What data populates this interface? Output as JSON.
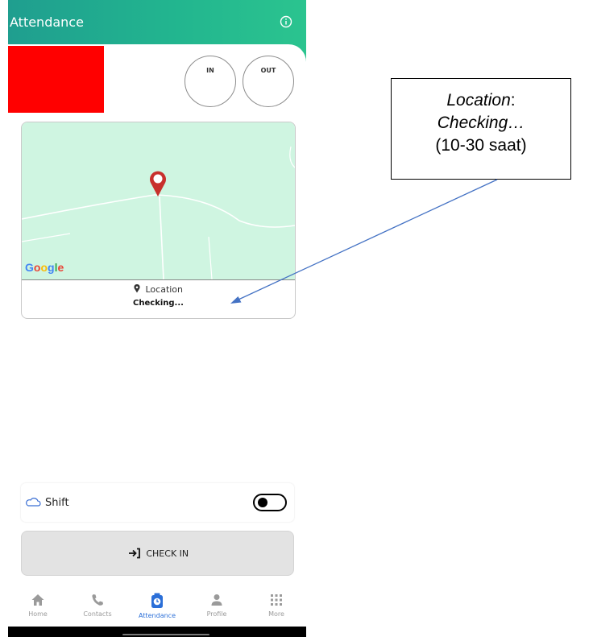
{
  "header": {
    "title": "Attendance",
    "info_icon": "info-circle-icon"
  },
  "buttons": {
    "in_label": "IN",
    "out_label": "OUT"
  },
  "map": {
    "provider_label": "Google",
    "pin_icon": "map-pin-icon",
    "location_label": "Location",
    "status": "Checking..."
  },
  "shift": {
    "icon": "cloud-icon",
    "label": "Shift",
    "toggle_on": false
  },
  "checkin": {
    "icon": "sign-in-icon",
    "label": "CHECK IN"
  },
  "nav": {
    "items": [
      {
        "label": "Home",
        "icon": "home-icon",
        "active": false
      },
      {
        "label": "Contacts",
        "icon": "phone-icon",
        "active": false
      },
      {
        "label": "Attendance",
        "icon": "attendance-clock-icon",
        "active": true
      },
      {
        "label": "Profile",
        "icon": "person-icon",
        "active": false
      },
      {
        "label": "More",
        "icon": "grid-icon",
        "active": false
      }
    ]
  },
  "annotation": {
    "line1": "Location",
    "line1_suffix": ":",
    "line2": "Checking…",
    "line3": "(10-30 saat)"
  },
  "colors": {
    "header_start": "#1f9e8f",
    "header_end": "#2bc48f",
    "map_background": "#cff5e1",
    "pin": "#c8302c",
    "active_nav": "#2b6fd8",
    "annotation_arrow": "#4472c4",
    "placeholder_box": "#ff0000"
  }
}
